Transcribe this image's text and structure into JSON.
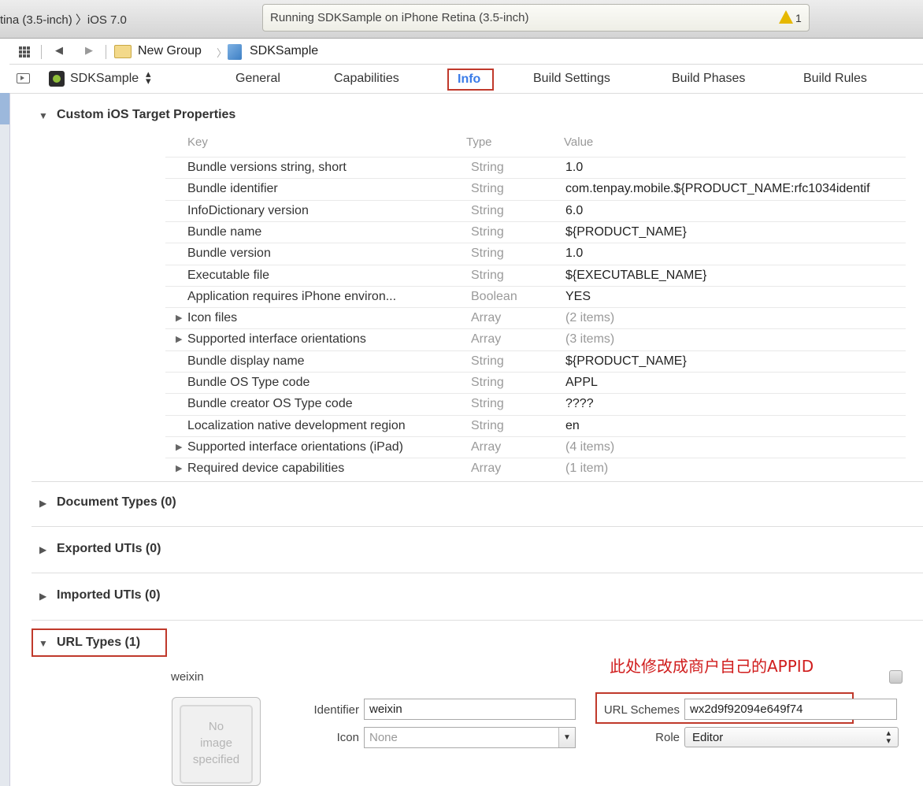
{
  "toolbar": {
    "scheme": "tina (3.5-inch) 〉iOS 7.0",
    "status": "Running SDKSample on iPhone Retina (3.5-inch)",
    "warning_count": "1"
  },
  "jumpbar": {
    "back": "◀",
    "forward": "▶",
    "crumbs": [
      "New Group",
      "SDKSample"
    ],
    "separator": "〉"
  },
  "editor": {
    "target": "SDKSample",
    "tabs": [
      "General",
      "Capabilities",
      "Info",
      "Build Settings",
      "Build Phases",
      "Build Rules"
    ],
    "active_tab": "Info"
  },
  "sections": {
    "custom": "Custom iOS Target Properties",
    "document_types": "Document Types (0)",
    "exported_utis": "Exported UTIs (0)",
    "imported_utis": "Imported UTIs (0)",
    "url_types": "URL Types (1)"
  },
  "table": {
    "headers": {
      "key": "Key",
      "type": "Type",
      "value": "Value"
    },
    "rows": [
      {
        "key": "Bundle versions string, short",
        "type": "String",
        "value": "1.0"
      },
      {
        "key": "Bundle identifier",
        "type": "String",
        "value": "com.tenpay.mobile.${PRODUCT_NAME:rfc1034identif"
      },
      {
        "key": "InfoDictionary version",
        "type": "String",
        "value": "6.0"
      },
      {
        "key": "Bundle name",
        "type": "String",
        "value": "${PRODUCT_NAME}"
      },
      {
        "key": "Bundle version",
        "type": "String",
        "value": "1.0"
      },
      {
        "key": "Executable file",
        "type": "String",
        "value": "${EXECUTABLE_NAME}"
      },
      {
        "key": "Application requires iPhone environ...",
        "type": "Boolean",
        "value": "YES"
      },
      {
        "key": "Icon files",
        "type": "Array",
        "value": "(2 items)"
      },
      {
        "key": "Supported interface orientations",
        "type": "Array",
        "value": "(3 items)"
      },
      {
        "key": "Bundle display name",
        "type": "String",
        "value": "${PRODUCT_NAME}"
      },
      {
        "key": "Bundle OS Type code",
        "type": "String",
        "value": "APPL"
      },
      {
        "key": "Bundle creator OS Type code",
        "type": "String",
        "value": "????"
      },
      {
        "key": "Localization native development region",
        "type": "String",
        "value": "en"
      },
      {
        "key": "Supported interface orientations (iPad)",
        "type": "Array",
        "value": "(4 items)"
      },
      {
        "key": "Required device capabilities",
        "type": "Array",
        "value": "(1 item)"
      }
    ]
  },
  "url_type": {
    "annotation": "此处修改成商户自己的APPID",
    "name": "weixin",
    "image_placeholder": [
      "No",
      "image",
      "specified"
    ],
    "identifier_label": "Identifier",
    "identifier_value": "weixin",
    "icon_label": "Icon",
    "icon_placeholder": "None",
    "schemes_label": "URL Schemes",
    "schemes_value": "wx2d9f92094e649f74",
    "role_label": "Role",
    "role_value": "Editor"
  },
  "colors": {
    "accent": "#3b7ce8",
    "highlight": "#c0392b",
    "annotation": "#d01c1c",
    "warning": "#e6b800"
  }
}
